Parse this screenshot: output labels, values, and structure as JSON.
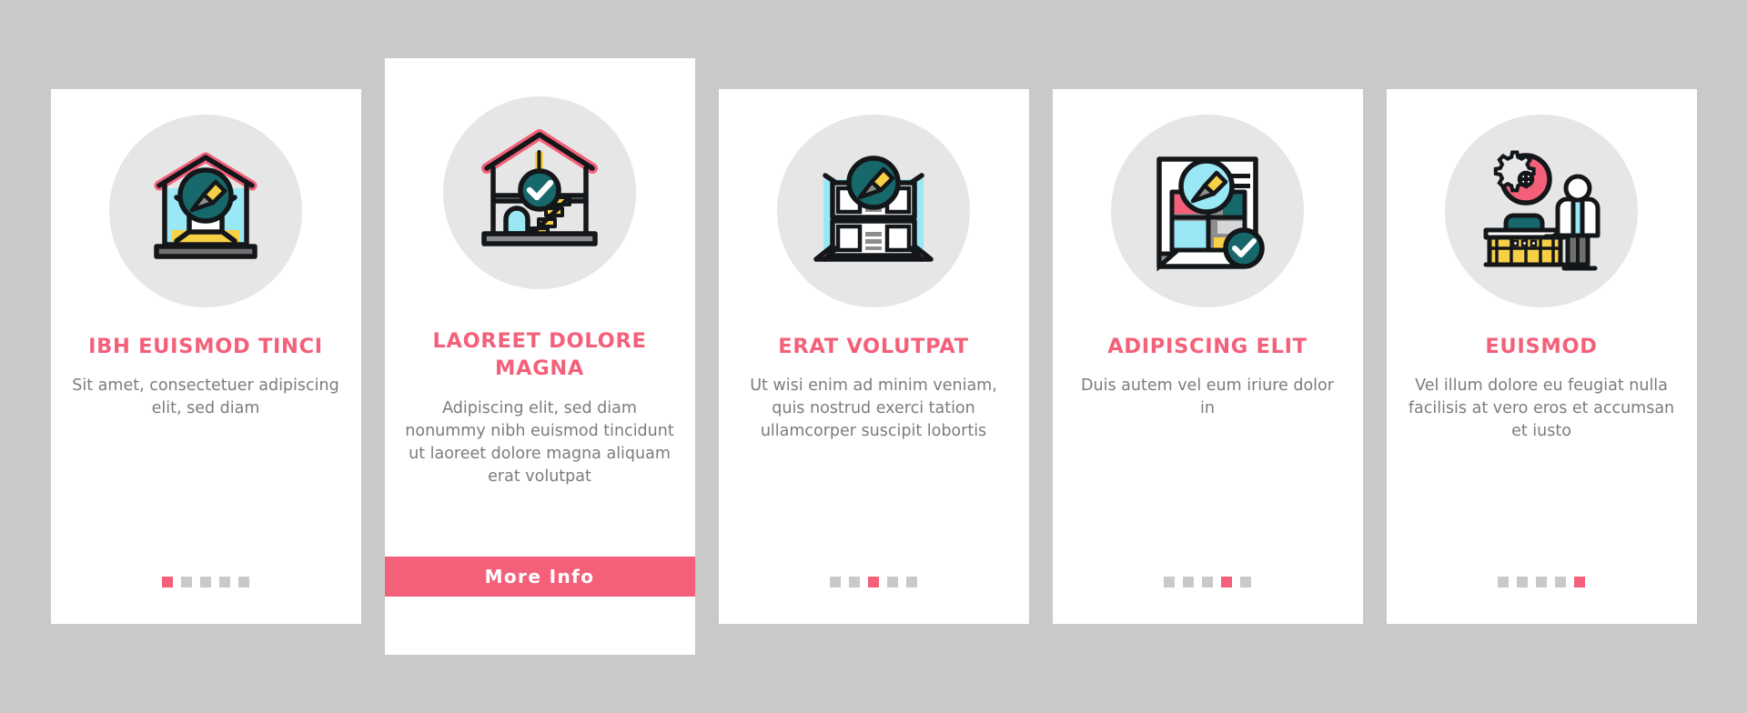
{
  "theme": {
    "background": "#c9c9c9",
    "card_background": "#ffffff",
    "accent_pink": "#f4607a",
    "icon_disc": "#e6e6e6",
    "body_text": "#7c7c7c",
    "dot_inactive": "#c9c9c9",
    "teal": "#17686b",
    "yellow": "#f7d046",
    "cyan": "#9ae8f5",
    "gray": "#8d8d8d",
    "outline": "#14171a"
  },
  "cards": [
    {
      "icon_name": "house-frame-with-compass-pencil-icon",
      "title": "Ibh Euismod Tinci",
      "description": "Sit amet, consectetuer adipiscing elit, sed diam",
      "featured": false,
      "pagination": {
        "count": 5,
        "active_index": 0
      },
      "cta": null
    },
    {
      "icon_name": "house-cutaway-stairs-check-icon",
      "title": "Laoreet Dolore Magna",
      "description": "Adipiscing elit, sed diam nonummy nibh euismod tincidunt ut laoreet dolore magna aliquam erat volutpat",
      "featured": true,
      "pagination": null,
      "cta": {
        "label": "More Info"
      }
    },
    {
      "icon_name": "two-storey-building-compass-pencil-icon",
      "title": "Erat Volutpat",
      "description": "Ut wisi enim ad minim veniam, quis nostrud exerci tation ullamcorper suscipit lobortis",
      "featured": false,
      "pagination": {
        "count": 5,
        "active_index": 2
      },
      "cta": null
    },
    {
      "icon_name": "floorplan-blueprint-pencil-check-icon",
      "title": "Adipiscing Elit",
      "description": "Duis autem vel eum iriure dolor in",
      "featured": false,
      "pagination": {
        "count": 5,
        "active_index": 3
      },
      "cta": null
    },
    {
      "icon_name": "architect-at-desk-gear-icon",
      "title": "Euismod",
      "description": "Vel illum dolore eu feugiat nulla facilisis at vero eros et accumsan et iusto",
      "featured": false,
      "pagination": {
        "count": 5,
        "active_index": 4
      },
      "cta": null
    }
  ]
}
